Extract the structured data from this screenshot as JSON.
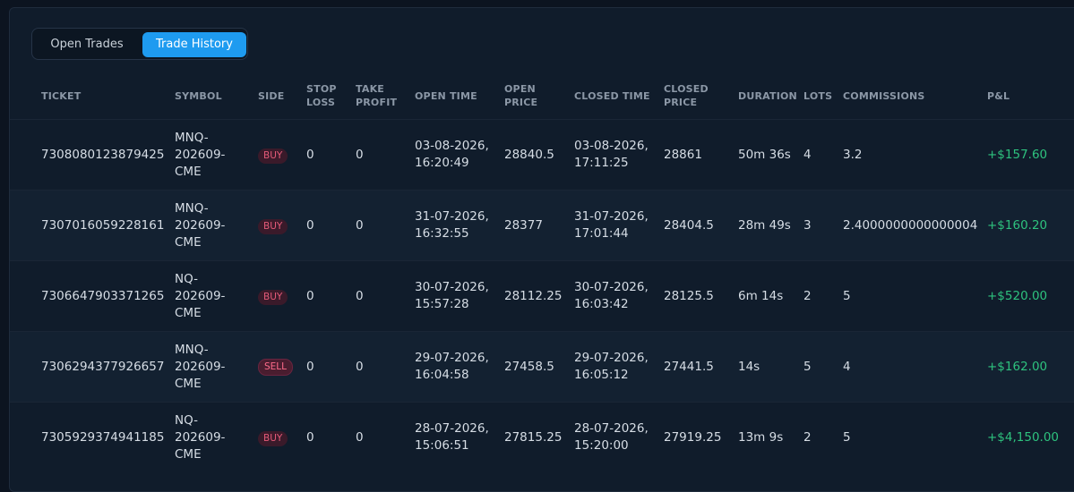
{
  "tabs": {
    "open_trades": "Open Trades",
    "trade_history": "Trade History",
    "active": "Trade History"
  },
  "columns": {
    "ticket": "TICKET",
    "symbol": "SYMBOL",
    "side": "SIDE",
    "stop_loss_1": "STOP",
    "stop_loss_2": "LOSS",
    "take_profit_1": "TAKE",
    "take_profit_2": "PROFIT",
    "open_time": "OPEN TIME",
    "open_price_1": "OPEN",
    "open_price_2": "PRICE",
    "closed_time": "CLOSED TIME",
    "closed_price_1": "CLOSED",
    "closed_price_2": "PRICE",
    "duration": "DURATION",
    "lots": "LOTS",
    "commissions": "COMMISSIONS",
    "pnl": "P&L"
  },
  "rows": [
    {
      "ticket": "7308080123879425",
      "symbol_1": "MNQ-",
      "symbol_2": "202609-",
      "symbol_3": "CME",
      "side": "BUY",
      "stop_loss": "0",
      "take_profit": "0",
      "open_date": "03-08-2026,",
      "open_clock": "16:20:49",
      "open_price": "28840.5",
      "close_date": "03-08-2026,",
      "close_clock": "17:11:25",
      "closed_price": "28861",
      "duration": "50m 36s",
      "lots": "4",
      "commissions": "3.2",
      "pnl": "+$157.60"
    },
    {
      "ticket": "7307016059228161",
      "symbol_1": "MNQ-",
      "symbol_2": "202609-",
      "symbol_3": "CME",
      "side": "BUY",
      "stop_loss": "0",
      "take_profit": "0",
      "open_date": "31-07-2026,",
      "open_clock": "16:32:55",
      "open_price": "28377",
      "close_date": "31-07-2026,",
      "close_clock": "17:01:44",
      "closed_price": "28404.5",
      "duration": "28m 49s",
      "lots": "3",
      "commissions": "2.4000000000000004",
      "pnl": "+$160.20"
    },
    {
      "ticket": "7306647903371265",
      "symbol_1": "NQ-",
      "symbol_2": "202609-",
      "symbol_3": "CME",
      "side": "BUY",
      "stop_loss": "0",
      "take_profit": "0",
      "open_date": "30-07-2026,",
      "open_clock": "15:57:28",
      "open_price": "28112.25",
      "close_date": "30-07-2026,",
      "close_clock": "16:03:42",
      "closed_price": "28125.5",
      "duration": "6m 14s",
      "lots": "2",
      "commissions": "5",
      "pnl": "+$520.00"
    },
    {
      "ticket": "7306294377926657",
      "symbol_1": "MNQ-",
      "symbol_2": "202609-",
      "symbol_3": "CME",
      "side": "SELL",
      "stop_loss": "0",
      "take_profit": "0",
      "open_date": "29-07-2026,",
      "open_clock": "16:04:58",
      "open_price": "27458.5",
      "close_date": "29-07-2026,",
      "close_clock": "16:05:12",
      "closed_price": "27441.5",
      "duration": "14s",
      "lots": "5",
      "commissions": "4",
      "pnl": "+$162.00"
    },
    {
      "ticket": "7305929374941185",
      "symbol_1": "NQ-",
      "symbol_2": "202609-",
      "symbol_3": "CME",
      "side": "BUY",
      "stop_loss": "0",
      "take_profit": "0",
      "open_date": "28-07-2026,",
      "open_clock": "15:06:51",
      "open_price": "27815.25",
      "close_date": "28-07-2026,",
      "close_clock": "15:20:00",
      "closed_price": "27919.25",
      "duration": "13m 9s",
      "lots": "2",
      "commissions": "5",
      "pnl": "+$4,150.00"
    }
  ],
  "colors": {
    "background": "#0c1420",
    "panel": "#101c2b",
    "accent": "#1e9bf0",
    "profit": "#2ec27e",
    "side_badge": "#e35a78"
  }
}
